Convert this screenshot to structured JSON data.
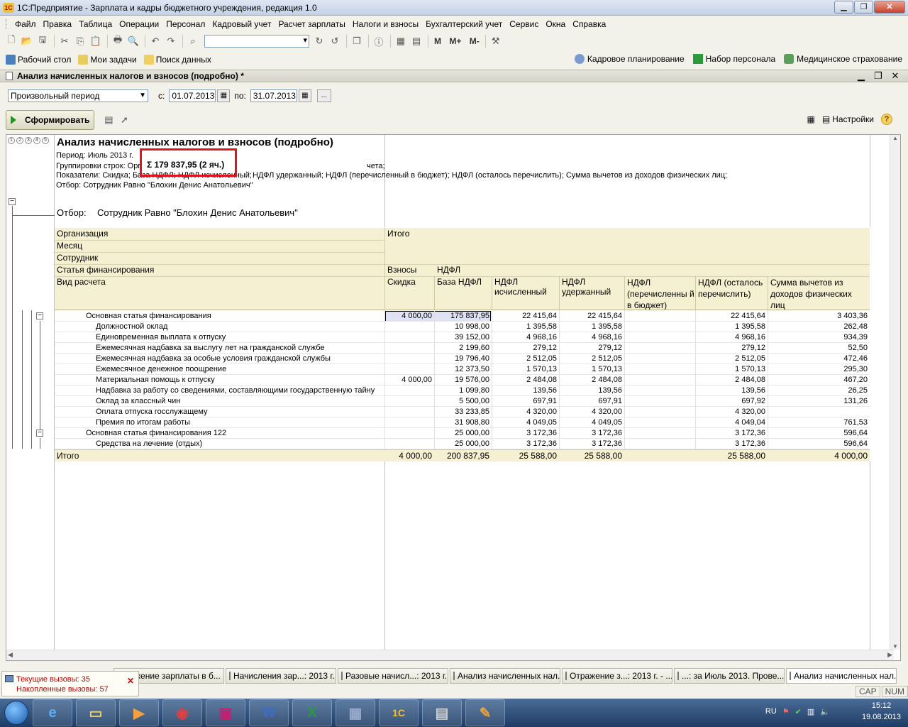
{
  "app": {
    "title": "1С:Предприятие - Зарплата и кадры бюджетного учреждения, редакция 1.0",
    "window_buttons": [
      "▁",
      "❐",
      "✕"
    ]
  },
  "menu": [
    "Файл",
    "Правка",
    "Таблица",
    "Операции",
    "Персонал",
    "Кадровый учет",
    "Расчет зарплаты",
    "Налоги и взносы",
    "Бухгалтерский учет",
    "Сервис",
    "Окна",
    "Справка"
  ],
  "toolbar": {
    "m_buttons": [
      "M",
      "M+",
      "M-"
    ]
  },
  "nav": {
    "left": [
      "Рабочий стол",
      "Мои задачи",
      "Поиск данных"
    ],
    "right": [
      "Кадровое планирование",
      "Набор персонала",
      "Медицинское страхование"
    ]
  },
  "document": {
    "title": "Анализ начисленных налогов и взносов (подробно) *",
    "period_type": "Произвольный период",
    "from_label": "с:",
    "from_date": "01.07.2013",
    "to_label": "по:",
    "to_date": "31.07.2013",
    "generate_label": "Сформировать",
    "settings_label": "Настройки",
    "more_label": "..."
  },
  "report": {
    "level_buttons": [
      "1",
      "2",
      "3",
      "4",
      "5"
    ],
    "title": "Анализ начисленных налогов и взносов (подробно)",
    "period_line": "Период: Июль 2013 г.",
    "grouping_prefix": "Группировки строк: Орг",
    "grouping_suffix": "чета;",
    "indicators_prefix": "Показатели: Скидка; База НДФЛ; НДФЛ исчисленный;",
    "indicators_suffix": "НДФЛ удержанный; НДФЛ (перечисленный в бюджет); НДФЛ (осталось перечислить); Сумма вычетов из доходов физических лиц;",
    "filter_line": "Отбор: Сотрудник Равно \"Блохин Денис Анатольевич\"",
    "filter_label": "Отбор:",
    "filter_value": "Сотрудник Равно \"Блохин Денис Анатольевич\"",
    "sum_tooltip": "Σ 179 837,95 (2 яч.)",
    "headers": {
      "org": "Организация",
      "month": "Месяц",
      "employee": "Сотрудник",
      "fin": "Статья финансирования",
      "calc": "Вид расчета",
      "total_col": "Итого",
      "contrib": "Взносы",
      "ndfl": "НДФЛ",
      "discount": "Скидка",
      "base": "База НДФЛ",
      "calculated": "НДФЛ исчисленный",
      "withheld": "НДФЛ удержанный",
      "transferred": "НДФЛ (перечисленны й в бюджет)",
      "remaining": "НДФЛ (осталось перечислить)",
      "deductions": "Сумма вычетов из доходов физических лиц"
    },
    "rows": [
      {
        "name": "Основная статья финансирования",
        "level": 0,
        "discount": "4 000,00",
        "base": "175 837,95",
        "calc": "22 415,64",
        "withheld": "22 415,64",
        "transferred": "",
        "remaining": "22 415,64",
        "deduct": "3 403,36"
      },
      {
        "name": "Должностной оклад",
        "level": 1,
        "discount": "",
        "base": "10 998,00",
        "calc": "1 395,58",
        "withheld": "1 395,58",
        "transferred": "",
        "remaining": "1 395,58",
        "deduct": "262,48"
      },
      {
        "name": "Единовременная выплата к отпуску",
        "level": 1,
        "discount": "",
        "base": "39 152,00",
        "calc": "4 968,16",
        "withheld": "4 968,16",
        "transferred": "",
        "remaining": "4 968,16",
        "deduct": "934,39"
      },
      {
        "name": "Ежемесячная надбавка за выслугу лет на гражданской службе",
        "level": 1,
        "discount": "",
        "base": "2 199,60",
        "calc": "279,12",
        "withheld": "279,12",
        "transferred": "",
        "remaining": "279,12",
        "deduct": "52,50"
      },
      {
        "name": "Ежемесячная надбавка за особые условия гражданской службы",
        "level": 1,
        "discount": "",
        "base": "19 796,40",
        "calc": "2 512,05",
        "withheld": "2 512,05",
        "transferred": "",
        "remaining": "2 512,05",
        "deduct": "472,46"
      },
      {
        "name": "Ежемесячное денежное поощрение",
        "level": 1,
        "discount": "",
        "base": "12 373,50",
        "calc": "1 570,13",
        "withheld": "1 570,13",
        "transferred": "",
        "remaining": "1 570,13",
        "deduct": "295,30"
      },
      {
        "name": "Материальная помощь к отпуску",
        "level": 1,
        "discount": "4 000,00",
        "base": "19 576,00",
        "calc": "2 484,08",
        "withheld": "2 484,08",
        "transferred": "",
        "remaining": "2 484,08",
        "deduct": "467,20"
      },
      {
        "name": "Надбавка за работу со сведениями, составляющими государственную тайну",
        "level": 1,
        "discount": "",
        "base": "1 099,80",
        "calc": "139,56",
        "withheld": "139,56",
        "transferred": "",
        "remaining": "139,56",
        "deduct": "26,25"
      },
      {
        "name": "Оклад за классный чин",
        "level": 1,
        "discount": "",
        "base": "5 500,00",
        "calc": "697,91",
        "withheld": "697,91",
        "transferred": "",
        "remaining": "697,92",
        "deduct": "131,26"
      },
      {
        "name": "Оплата отпуска госслужащему",
        "level": 1,
        "discount": "",
        "base": "33 233,85",
        "calc": "4 320,00",
        "withheld": "4 320,00",
        "transferred": "",
        "remaining": "4 320,00",
        "deduct": ""
      },
      {
        "name": "Премия по итогам работы",
        "level": 1,
        "discount": "",
        "base": "31 908,80",
        "calc": "4 049,05",
        "withheld": "4 049,05",
        "transferred": "",
        "remaining": "4 049,04",
        "deduct": "761,53"
      },
      {
        "name": "Основная статья финансирования 122",
        "level": 0,
        "discount": "",
        "base": "25 000,00",
        "calc": "3 172,36",
        "withheld": "3 172,36",
        "transferred": "",
        "remaining": "3 172,36",
        "deduct": "596,64"
      },
      {
        "name": "Средства на лечение (отдых)",
        "level": 1,
        "discount": "",
        "base": "25 000,00",
        "calc": "3 172,36",
        "withheld": "3 172,36",
        "transferred": "",
        "remaining": "3 172,36",
        "deduct": "596,64"
      }
    ],
    "total": {
      "name": "Итого",
      "discount": "4 000,00",
      "base": "200 837,95",
      "calc": "25 588,00",
      "withheld": "25 588,00",
      "transferred": "",
      "remaining": "25 588,00",
      "deduct": "4 000,00"
    }
  },
  "calls": {
    "current": "Текущие вызовы: 35",
    "cumulative": "Накопленные вызовы: 57"
  },
  "tabs": [
    "...жение зарплаты в б...",
    "Начисления зар...: 2013 г.",
    "Разовые начисл...: 2013 г.",
    "Анализ начисленных нал...",
    "Отражение з...: 2013 г. - ...",
    "...: за Июль 2013. Прове...",
    "Анализ начисленных нал..."
  ],
  "status": [
    "CAP",
    "NUM"
  ],
  "taskbar": {
    "lang": "RU",
    "time": "15:12",
    "date": "19.08.2013"
  }
}
